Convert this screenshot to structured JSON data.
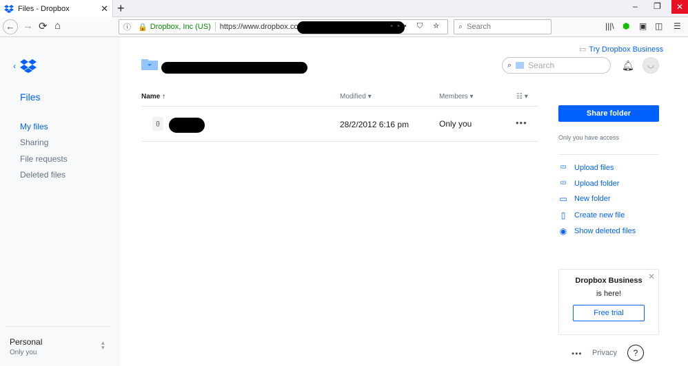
{
  "browser": {
    "tab_title": "Files - Dropbox",
    "tab_close": "✕",
    "new_tab": "+",
    "back": "←",
    "forward": "→",
    "reload": "⟳",
    "home": "⌂",
    "identity": "Dropbox, Inc (US)",
    "url": "https://www.dropbox.com/h",
    "page_actions": "••• ⛉ ☆",
    "search_placeholder": "Search",
    "win_min": "–",
    "win_restore": "❐",
    "win_close": "✕",
    "library": "|||\\",
    "menu": "☰"
  },
  "sidebar": {
    "collapse": "‹",
    "section": "Files",
    "items": [
      {
        "label": "My files"
      },
      {
        "label": "Sharing"
      },
      {
        "label": "File requests"
      },
      {
        "label": "Deleted files"
      }
    ],
    "account": "Personal",
    "account_sub": "Only you"
  },
  "header": {
    "try_business": "Try Dropbox Business",
    "search_placeholder": "Search"
  },
  "table": {
    "columns": {
      "name": "Name ↑",
      "modified": "Modified ▾",
      "members": "Members ▾",
      "view": "☷ ▾"
    },
    "rows": [
      {
        "icon_text": "{}",
        "modified": "28/2/2012 6:16 pm",
        "members": "Only you",
        "more": "•••"
      }
    ]
  },
  "right_panel": {
    "share_button": "Share folder",
    "access_text": "Only you have access",
    "actions": [
      {
        "label": "Upload files"
      },
      {
        "label": "Upload folder"
      },
      {
        "label": "New folder"
      },
      {
        "label": "Create new file"
      },
      {
        "label": "Show deleted files"
      }
    ],
    "promo": {
      "title": "Dropbox Business",
      "subtitle": "is here!",
      "button": "Free trial",
      "close": "✕"
    }
  },
  "footer": {
    "more": "•••",
    "privacy": "Privacy",
    "help": "?"
  },
  "colors": {
    "accent": "#0061fe",
    "sidebar_bg": "#f7f9fa",
    "secure_green": "#058b00"
  }
}
